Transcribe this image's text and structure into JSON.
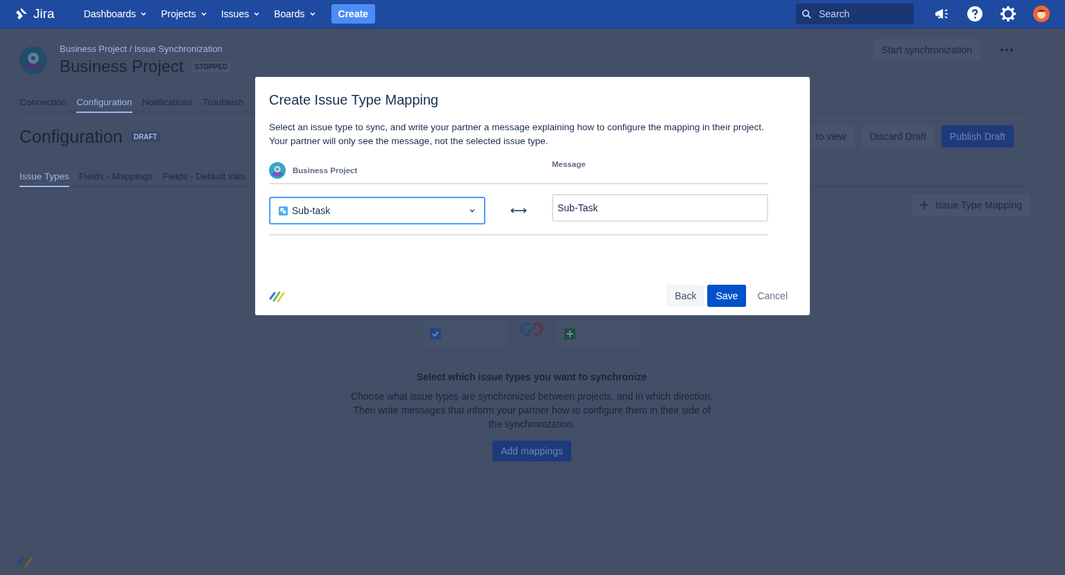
{
  "top_nav": {
    "product": "Jira",
    "menus": [
      {
        "label": "Dashboards"
      },
      {
        "label": "Projects"
      },
      {
        "label": "Issues"
      },
      {
        "label": "Boards"
      }
    ],
    "create_button": "Create",
    "search": {
      "placeholder": "Search"
    }
  },
  "project_header": {
    "breadcrumb": "Business Project / Issue Synchronization",
    "title": "Business Project",
    "status": "STOPPED",
    "action": "Start synchronization"
  },
  "tabs": [
    {
      "label": "Connection",
      "selected": false
    },
    {
      "label": "Configuration",
      "selected": true
    },
    {
      "label": "Notifications",
      "selected": false
    },
    {
      "label": "Troublesh",
      "selected": false
    }
  ],
  "configuration": {
    "title": "Configuration",
    "badge": "DRAFT",
    "buttons": [
      {
        "label": "to view",
        "kind": "subtle"
      },
      {
        "label": "Discard Draft",
        "kind": "subtle"
      },
      {
        "label": "Publish Draft",
        "kind": "primary"
      }
    ]
  },
  "sub_tabs": [
    {
      "label": "Issue Types",
      "selected": true
    },
    {
      "label": "Fields - Mappings",
      "selected": false
    },
    {
      "label": "Fields - Default valu",
      "selected": false
    }
  ],
  "add_mapping_button": "Issue Type Mapping",
  "empty_state": {
    "heading": "Select which issue types you want to synchronize",
    "text": "Choose what issue types are synchronized between projects, and in which direction. Then write messages that inform your partner how to configure them in their side of the synchronization.",
    "button": "Add mappings"
  },
  "dialog": {
    "title": "Create Issue Type Mapping",
    "description": "Select an issue type to sync, and write your partner a message explaining how to configure the mapping in their project. Your partner will only see the message, not the selected issue type.",
    "left_header": "Business Project",
    "right_header": "Message",
    "issue_type": "Sub-task",
    "message": "Sub-Task",
    "buttons": [
      {
        "label": "Back",
        "kind": "subtle"
      },
      {
        "label": "Save",
        "kind": "primary"
      },
      {
        "label": "Cancel",
        "kind": "link"
      }
    ]
  }
}
